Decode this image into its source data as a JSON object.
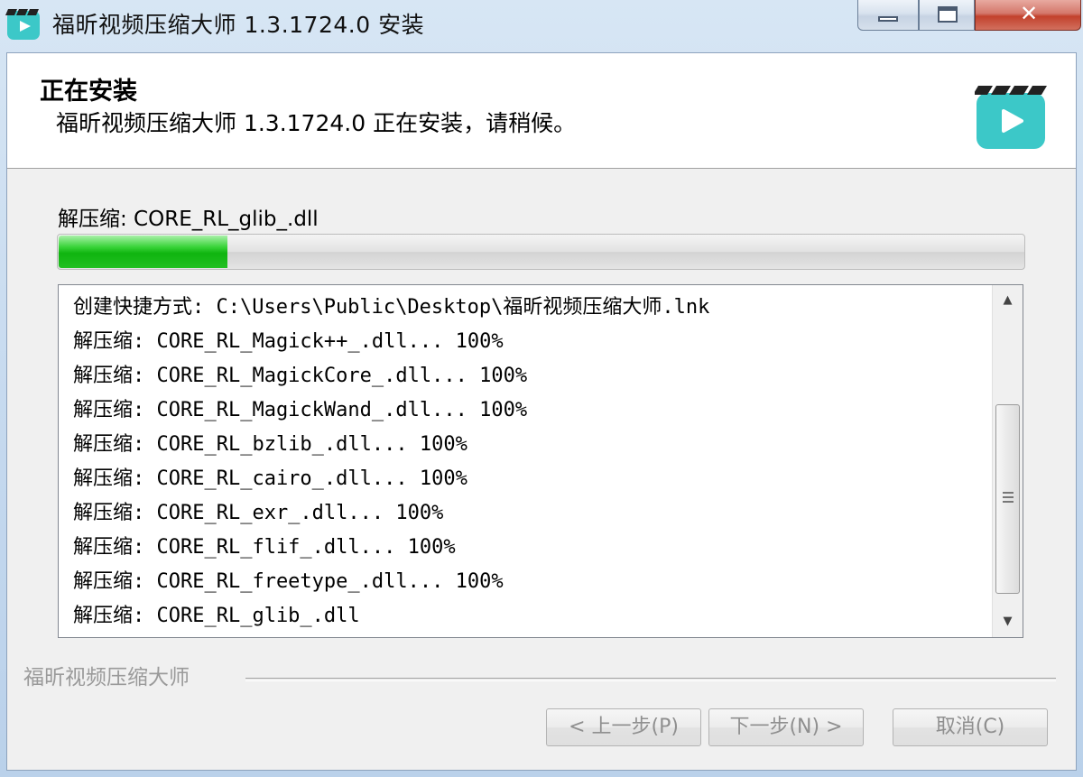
{
  "window": {
    "title": "福昕视频压缩大师 1.3.1724.0 安装",
    "close_glyph": "✕"
  },
  "header": {
    "title": "正在安装",
    "subtitle": "福昕视频压缩大师 1.3.1724.0 正在安装，请稍候。"
  },
  "status": {
    "current": "解压缩: CORE_RL_glib_.dll",
    "progress_fraction": 0.175
  },
  "log": {
    "lines": [
      "创建快捷方式: C:\\Users\\Public\\Desktop\\福昕视频压缩大师.lnk",
      "解压缩: CORE_RL_Magick++_.dll... 100%",
      "解压缩: CORE_RL_MagickCore_.dll... 100%",
      "解压缩: CORE_RL_MagickWand_.dll... 100%",
      "解压缩: CORE_RL_bzlib_.dll... 100%",
      "解压缩: CORE_RL_cairo_.dll... 100%",
      "解压缩: CORE_RL_exr_.dll... 100%",
      "解压缩: CORE_RL_flif_.dll... 100%",
      "解压缩: CORE_RL_freetype_.dll... 100%",
      "解压缩: CORE_RL_glib_.dll"
    ]
  },
  "footer": {
    "brand": "福昕视频压缩大师",
    "back_label": "< 上一步(P)",
    "next_label": "下一步(N) >",
    "cancel_label": "取消(C)"
  },
  "colors": {
    "accent": "#3cc8c8",
    "progress": "#1bbf1b"
  }
}
